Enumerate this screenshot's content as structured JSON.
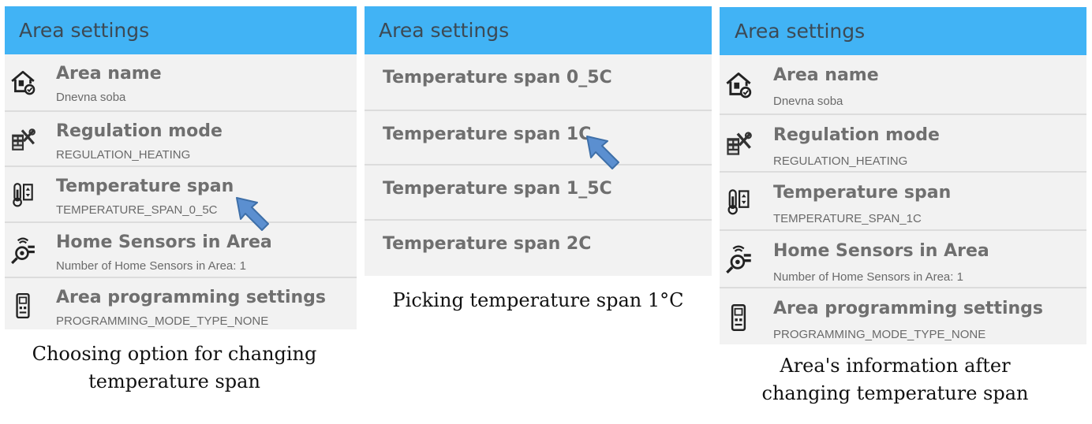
{
  "panel1": {
    "header": "Area settings",
    "rows": [
      {
        "title": "Area name",
        "subtitle": "Dnevna soba",
        "icon": "home-settings-icon"
      },
      {
        "title": "Regulation mode",
        "subtitle": "REGULATION_HEATING",
        "icon": "tools-icon"
      },
      {
        "title": "Temperature span",
        "subtitle": "TEMPERATURE_SPAN_0_5C",
        "icon": "thermometer-icon"
      },
      {
        "title": "Home Sensors in Area",
        "subtitle": "Number of Home Sensors in Area: 1",
        "icon": "sensor-icon"
      },
      {
        "title": "Area programming settings",
        "subtitle": "PROGRAMMING_MODE_TYPE_NONE",
        "icon": "thermostat-device-icon"
      }
    ],
    "caption": [
      "Choosing option for changing",
      "temperature span"
    ]
  },
  "panel2": {
    "header": "Area settings",
    "options": [
      "Temperature span 0_5C",
      "Temperature span 1C",
      "Temperature span 1_5C",
      "Temperature span 2C"
    ],
    "caption": "Picking temperature span 1°C"
  },
  "panel3": {
    "header": "Area settings",
    "rows": [
      {
        "title": "Area name",
        "subtitle": "Dnevna soba",
        "icon": "home-settings-icon"
      },
      {
        "title": "Regulation mode",
        "subtitle": "REGULATION_HEATING",
        "icon": "tools-icon"
      },
      {
        "title": "Temperature span",
        "subtitle": "TEMPERATURE_SPAN_1C",
        "icon": "thermometer-icon"
      },
      {
        "title": "Home Sensors in Area",
        "subtitle": "Number of Home Sensors in Area: 1",
        "icon": "sensor-icon"
      },
      {
        "title": "Area programming settings",
        "subtitle": "PROGRAMMING_MODE_TYPE_NONE",
        "icon": "thermostat-device-icon"
      }
    ],
    "caption": [
      "Area's information after",
      "changing temperature span"
    ]
  },
  "colors": {
    "header": "#41b3f5",
    "arrow": "#5b8fd0",
    "panel": "#f2f2f2"
  }
}
